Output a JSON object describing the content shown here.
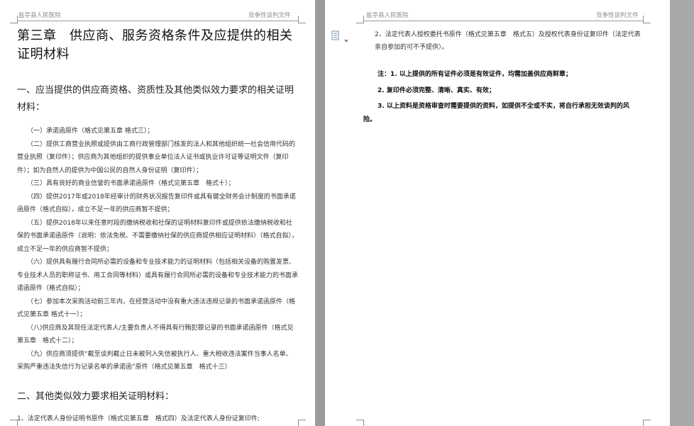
{
  "left_page": {
    "header_left": "盐亭县人民医院",
    "header_right": "竞争性谈判文件",
    "chapter_title": "第三章　供应商、服务资格条件及应提供的相关证明材料",
    "section1_title": "一、应当提供的供应商资格、资质性及其他类似效力要求的相关证明材料：",
    "items": [
      "（一）承诺函原件（格式见第五章 格式三）；",
      "（二）提供工商营业执照或提供由工商行政管理部门核发的法人和其他组织统一社会信用代码的营业执照（复印件）；供应商为其他组织的提供事业单位法人证书或执业许可证等证明文件（复印件）；如为自然人的提供为中国公民的自然人身份证明（复印件）；",
      "（三）具有良好的商业信誉的书面承诺函原件（格式见第五章　格式十）；",
      "（四）提供2017年或2018年经审计的财务状况报告复印件或具有健全财务会计制度的书面承诺函原件（格式自拟），成立不足一年的供应商暂不提供；",
      "（五）提供2018年以来任意时段的缴纳税收和社保的证明材料复印件或提供依法缴纳税收和社保的书面承诺函原件（说明：依法免税、不需要缴纳社保的供应商提供相应证明材料）（格式自拟），成立不足一年的供应商暂不提供；",
      "（六）提供具有履行合同所必需的设备和专业技术能力的证明材料（包括相关设备的购置发票、专业技术人员的职称证书、用工合同等材料）或具有履行合同所必需的设备和专业技术能力的书面承诺函原件（格式自拟）；",
      "（七）参加本次采购活动前三年内，在经营活动中没有重大违法违规记录的书面承诺函原件（格式见第五章 格式十一）；",
      "（八)供应商及其现任法定代表人/主要负责人不得具有行贿犯罪记录的书面承诺函原件（格式见第五章　格式十二）；",
      "（九）供应商须提供“截至谈判截止日未被列入失信被执行人、重大税收违法案件当事人名单、采购严重违法失信行为记录名单的承诺函”原件（格式见第五章　格式十三）"
    ],
    "section2_title": "二、其他类似效力要求相关证明材料：",
    "section2_item1": "1、法定代表人身份证明书原件（格式见第五章　格式四）及法定代表人身份证复印件;"
  },
  "right_page": {
    "header_left": "盐亭县人民医院",
    "header_right": "竞争性谈判文件",
    "item2": "2、法定代表人授权委托书原件（格式见第五章　格式五）及授权代表身份证复印件（法定代表亲自参加的可不予提供）。",
    "notes": [
      "注：1. 以上提供的所有证件必须是有效证件，均需加盖供应商鲜章；",
      "2. 复印件必须完整、清晰、真实、有效；",
      "3. 以上资料是资格审查时需要提供的资料，如提供不全或不实，将自行承担无效谈判的风险。"
    ]
  },
  "colors": {
    "background": "#a0a0a0",
    "page": "#ffffff",
    "text": "#333333",
    "header_text": "#8c8c8c"
  },
  "icons": [
    "document-icon",
    "dropdown-arrow-icon"
  ]
}
